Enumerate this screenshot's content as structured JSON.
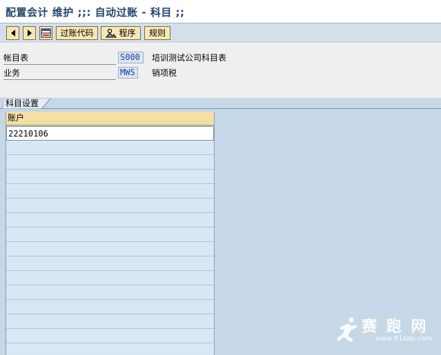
{
  "window": {
    "title": "配置会计 维护 ;;: 自动过账 - 科目 ;;"
  },
  "toolbar": {
    "prev_icon": "triangle-left-icon",
    "next_icon": "triangle-right-icon",
    "table_icon": "table-view-icon",
    "posting_key_label": "过账代码",
    "procedure_icon": "person-mountain-icon",
    "procedure_label": "程序",
    "rules_label": "规则"
  },
  "header": {
    "chart_of_accounts_label": "帐目表",
    "chart_of_accounts_value": "S000",
    "chart_of_accounts_desc": "培训测试公司科目表",
    "transaction_label": "业务",
    "transaction_value": "MWS",
    "transaction_desc": "销项税"
  },
  "tab": {
    "label": "科目设置"
  },
  "table": {
    "columns": [
      "账户"
    ],
    "rows": [
      "22210106",
      "",
      "",
      "",
      "",
      "",
      "",
      "",
      "",
      "",
      "",
      "",
      "",
      "",
      "",
      ""
    ]
  },
  "watermark": {
    "text": "赛 跑 网",
    "url": "www.91sap.com"
  },
  "colors": {
    "title_text": "#24466b",
    "toolbar_bg": "#d4dfea",
    "button_bg": "#f6e7b4",
    "header_bg": "#efefee",
    "table_area_bg": "#c6d7e7",
    "column_header_bg": "#f3dfa6",
    "row_bg": "#d9e6f4",
    "value_text": "#1d3ea8"
  }
}
